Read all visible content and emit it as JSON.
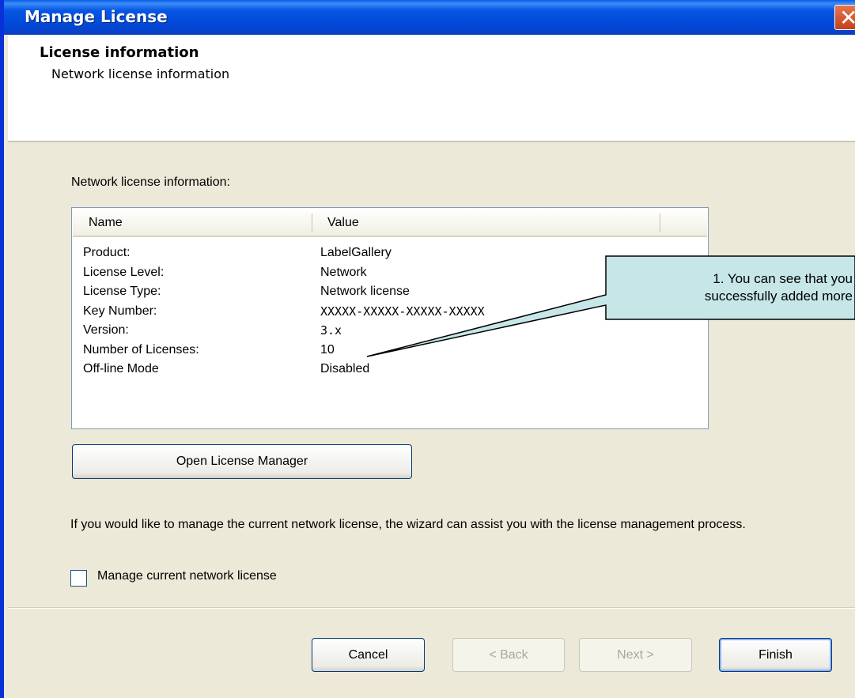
{
  "window": {
    "title": "Manage License",
    "close_label": "✕"
  },
  "header": {
    "title": "License information",
    "subtitle": "Network license information"
  },
  "section_label": "Network license information:",
  "listview": {
    "columns": [
      "Name",
      "Value"
    ],
    "rows": [
      {
        "name": "Product:",
        "value": "LabelGallery"
      },
      {
        "name": "License Level:",
        "value": "Network"
      },
      {
        "name": "License Type:",
        "value": "Network license"
      },
      {
        "name": "Key Number:",
        "value": "XXXXX-XXXXX-XXXXX-XXXXX"
      },
      {
        "name": "Version:",
        "value": "3.x"
      },
      {
        "name": "Number of Licenses:",
        "value": "10"
      },
      {
        "name": "Off-line Mode",
        "value": "Disabled"
      }
    ]
  },
  "open_license_manager_label": "Open License Manager",
  "description": "If you would like to manage the current network license, the wizard can assist you with the license management process.",
  "checkbox": {
    "label": "Manage current network license",
    "checked": false
  },
  "buttons": {
    "cancel": "Cancel",
    "back": "< Back",
    "next": "Next >",
    "finish": "Finish"
  },
  "callout": {
    "line1": "1. You can see that you",
    "line2": "successfully added more"
  },
  "colors": {
    "titlebar": "#0148d8",
    "dialog_bg": "#ece9d8",
    "callout_fill": "#c6e6e8",
    "close_button": "#d9532b"
  }
}
